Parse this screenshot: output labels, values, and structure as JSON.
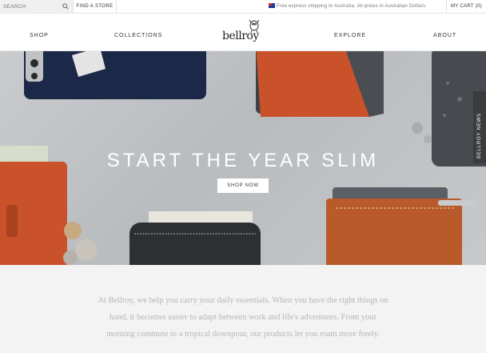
{
  "topbar": {
    "search_placeholder": "SEARCH",
    "find_store": "FIND A STORE",
    "shipping_notice": "Free express shipping to Australia. All prices in Australian Dollars.",
    "cart_label": "MY CART (0)"
  },
  "nav": {
    "shop": "SHOP",
    "collections": "COLLECTIONS",
    "logo": "bellroy",
    "explore": "EXPLORE",
    "about": "ABOUT"
  },
  "hero": {
    "title": "START THE YEAR SLIM",
    "button": "SHOP NOW",
    "news_tab": "BELLROY NEWS"
  },
  "intro": {
    "text": "At Bellroy, we help you carry your daily essentials. When you have the right things on hand, it becomes easier to adapt between work and life's adventures. From your morning commute to a tropical downpour, our products let you roam more freely."
  },
  "colors": {
    "accent_orange": "#c85a2a",
    "navy": "#1d2a4a",
    "charcoal": "#3a3c40"
  }
}
